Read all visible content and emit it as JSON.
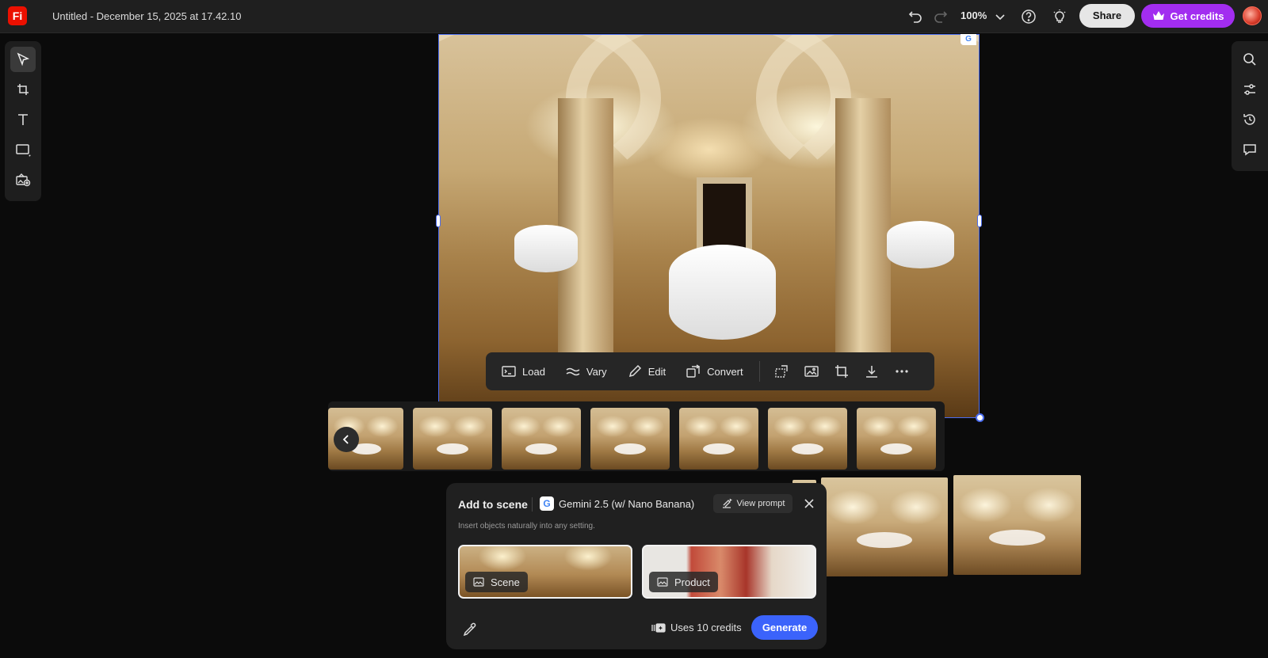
{
  "app": {
    "logo_text": "Fi",
    "doc_title": "Untitled - December 15, 2025 at 17.42.10"
  },
  "topbar": {
    "zoom": "100%",
    "share_label": "Share",
    "credits_label": "Get credits"
  },
  "canvas": {
    "badge": "G"
  },
  "toolbar": {
    "load": "Load",
    "vary": "Vary",
    "edit": "Edit",
    "convert": "Convert"
  },
  "panel": {
    "title": "Add to scene",
    "model_badge": "G",
    "model": "Gemini 2.5 (w/ Nano Banana)",
    "view_prompt": "View prompt",
    "subtitle": "Insert objects naturally into any setting.",
    "scene_label": "Scene",
    "product_label": "Product",
    "credits_text": "Uses 10 credits",
    "generate_label": "Generate"
  },
  "colors": {
    "accent": "#3b63fb",
    "credits": "#a22df0",
    "selection": "#4a6cf0",
    "logo": "#eb1000"
  }
}
